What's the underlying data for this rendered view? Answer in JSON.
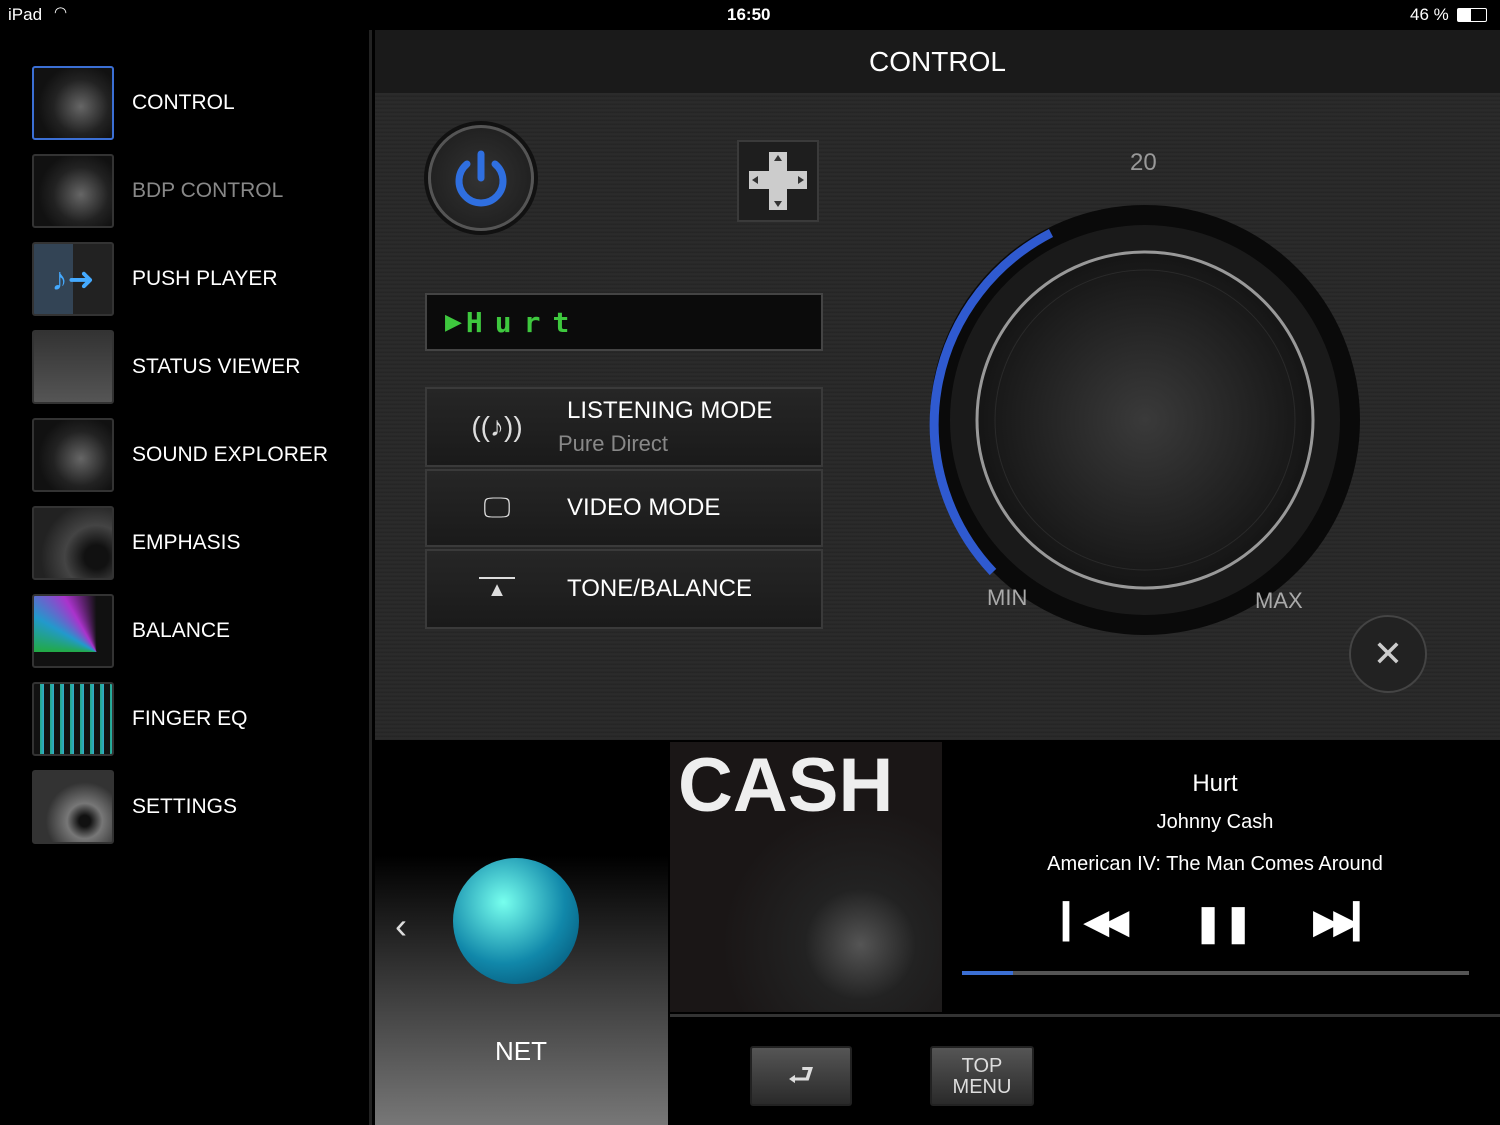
{
  "status": {
    "device": "iPad",
    "time": "16:50",
    "battery": "46 %",
    "battery_level": 46
  },
  "sidebar": {
    "items": [
      {
        "label": "CONTROL",
        "active": true
      },
      {
        "label": "BDP CONTROL",
        "disabled": true
      },
      {
        "label": "PUSH PLAYER"
      },
      {
        "label": "STATUS VIEWER"
      },
      {
        "label": "SOUND EXPLORER"
      },
      {
        "label": "EMPHASIS"
      },
      {
        "label": "BALANCE"
      },
      {
        "label": "FINGER EQ"
      },
      {
        "label": "SETTINGS"
      }
    ]
  },
  "header": {
    "title": "CONTROL"
  },
  "control": {
    "display_text": "Hurt",
    "listening_mode_label": "LISTENING MODE",
    "listening_mode_value": "Pure Direct",
    "video_mode_label": "VIDEO MODE",
    "tone_balance_label": "TONE/BALANCE",
    "volume": {
      "value": "20",
      "min_label": "MIN",
      "max_label": "MAX"
    }
  },
  "colors": {
    "accent": "#3b6fd4",
    "display_green": "#3ec83e"
  },
  "player": {
    "source": "NET",
    "album_art_text": "CASH",
    "title": "Hurt",
    "artist": "Johnny Cash",
    "album": "American IV: The Man Comes Around",
    "progress_percent": 10,
    "top_menu_label": "TOP MENU"
  }
}
